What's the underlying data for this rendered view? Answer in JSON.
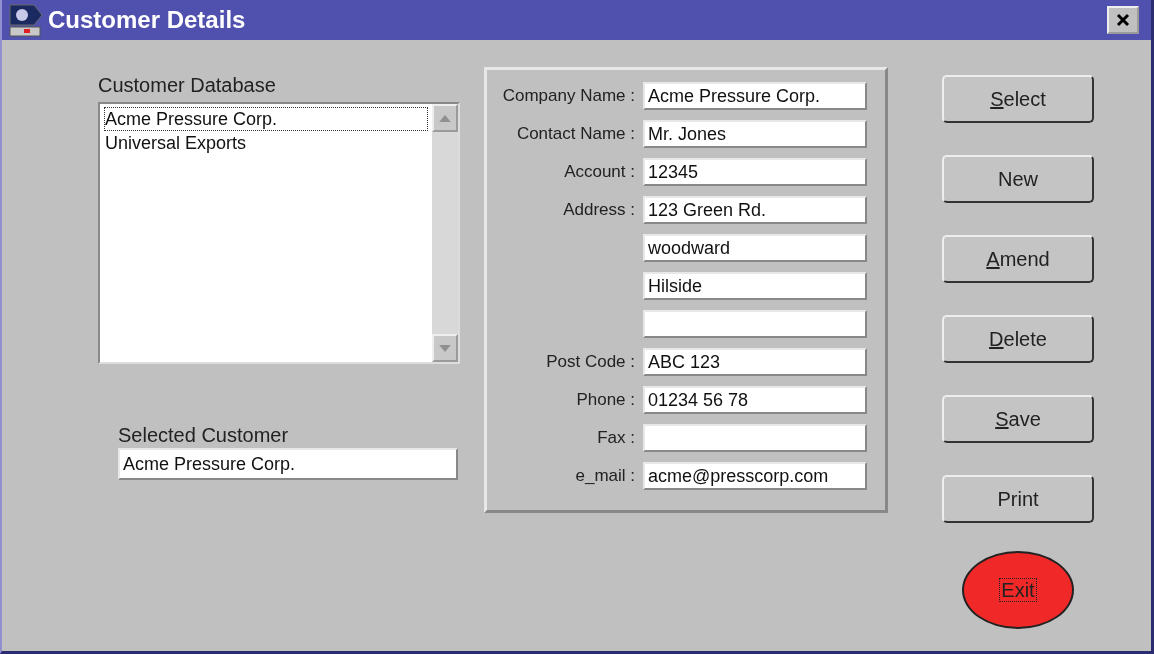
{
  "window": {
    "title": "Customer Details"
  },
  "customer_database": {
    "label": "Customer Database",
    "items": [
      {
        "text": "Acme Pressure Corp.",
        "selected": true
      },
      {
        "text": "Universal Exports",
        "selected": false
      }
    ]
  },
  "selected_customer": {
    "label": "Selected Customer",
    "value": "Acme Pressure Corp."
  },
  "details": [
    {
      "kind": "field",
      "label": "Company Name :",
      "value": "Acme Pressure Corp."
    },
    {
      "kind": "field",
      "label": "Contact Name :",
      "value": "Mr. Jones"
    },
    {
      "kind": "field",
      "label": "Account :",
      "value": "12345"
    },
    {
      "kind": "field",
      "label": "Address :",
      "value": "123 Green Rd."
    },
    {
      "kind": "field",
      "value": "woodward"
    },
    {
      "kind": "field",
      "value": "Hilside"
    },
    {
      "kind": "field"
    },
    {
      "kind": "field",
      "label": "Post Code :",
      "value": "ABC 123"
    },
    {
      "kind": "field",
      "label": "Phone :",
      "value": "01234 56 78"
    },
    {
      "kind": "field",
      "label": "Fax :"
    },
    {
      "kind": "field",
      "label": "e_mail :",
      "value": "acme@presscorp.com"
    }
  ],
  "buttons": [
    {
      "label": "Select",
      "kind": "rect",
      "mnemonic": true,
      "focused": false
    },
    {
      "label": "New",
      "kind": "rect",
      "mnemonic": false,
      "focused": false
    },
    {
      "label": "Amend",
      "kind": "rect",
      "mnemonic": true,
      "focused": false
    },
    {
      "label": "Delete",
      "kind": "rect",
      "mnemonic": true,
      "focused": false
    },
    {
      "label": "Save",
      "kind": "rect",
      "mnemonic": true,
      "focused": false
    },
    {
      "label": "Print",
      "kind": "rect",
      "mnemonic": false,
      "focused": false
    },
    {
      "label": "Exit",
      "kind": "oval",
      "mnemonic": false,
      "focused": true
    }
  ]
}
